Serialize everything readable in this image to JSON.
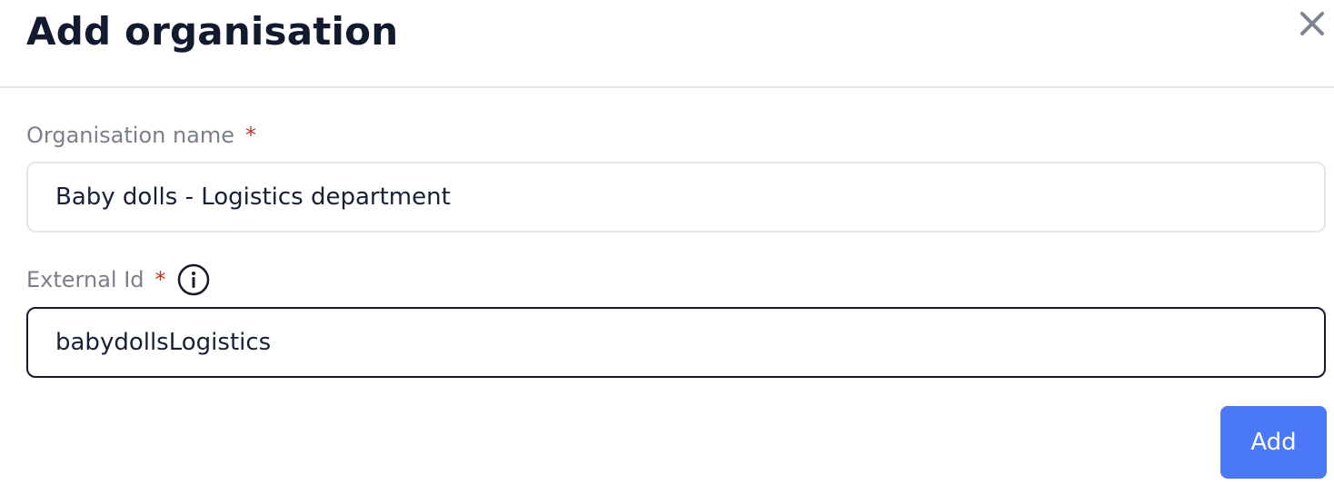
{
  "dialog": {
    "title": "Add organisation",
    "close_icon": "close-icon"
  },
  "fields": {
    "org_name": {
      "label": "Organisation name",
      "required_mark": "*",
      "value": "Baby dolls - Logistics department"
    },
    "external_id": {
      "label": "External Id",
      "required_mark": "*",
      "info_icon": "info-icon",
      "value": "babydollsLogistics"
    }
  },
  "actions": {
    "add_label": "Add"
  },
  "colors": {
    "primary": "#4a78f6",
    "required": "#c0392b",
    "title": "#121a30",
    "label": "#7a7f89"
  }
}
